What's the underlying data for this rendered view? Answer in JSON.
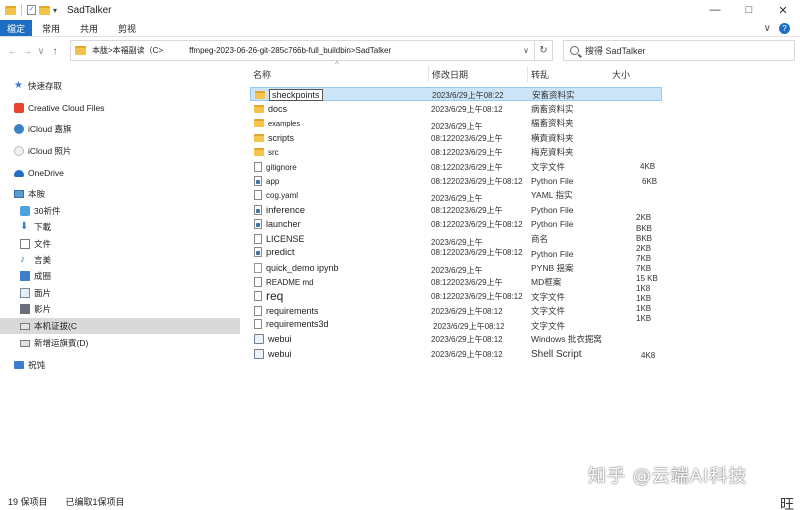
{
  "window": {
    "title": "SadTalker",
    "minimize": "—",
    "maximize": "□",
    "close": "✕",
    "quick_access_drop": "▾"
  },
  "ribbon": {
    "file": "檔定",
    "tabs": [
      "常用",
      "共用",
      "剪视"
    ],
    "expand": "∨",
    "help": "?"
  },
  "nav": {
    "back": "←",
    "forward": "→",
    "recent": "∨",
    "up": "↑",
    "path_part1": "本胧>本福副读（C>",
    "path_part2": "ffmpeg-2023-06-26-git-285c766b-full_buildbin>SadTalker",
    "address_drop": "∨",
    "refresh": "↻",
    "search_placeholder": "搜得 SadTalker"
  },
  "sidebar": {
    "items": [
      {
        "label": "快速存取",
        "icon": "star-icon"
      },
      {
        "label": "Creative Cloud Files",
        "icon": "creative-cloud-icon"
      },
      {
        "label": "iCloud 嘉旗",
        "icon": "icloud-drive-icon"
      },
      {
        "label": "iCloud 照片",
        "icon": "icloud-photos-icon"
      },
      {
        "label": "OneDrive",
        "icon": "onedrive-icon"
      },
      {
        "label": "本胺",
        "icon": "this-pc-icon"
      },
      {
        "label": "30祈件",
        "icon": "3d-objects-icon"
      },
      {
        "label": "下載",
        "icon": "download-icon"
      },
      {
        "label": "文件",
        "icon": "documents-icon"
      },
      {
        "label": "言美",
        "icon": "music-icon"
      },
      {
        "label": "成圈",
        "icon": "desktop-icon"
      },
      {
        "label": "面片",
        "icon": "pictures-icon"
      },
      {
        "label": "影片",
        "icon": "videos-icon"
      },
      {
        "label": "本机证拔(C",
        "icon": "local-disk-icon"
      },
      {
        "label": "新增运旗賓(D)",
        "icon": "drive-d-icon"
      },
      {
        "label": "祝饨",
        "icon": "network-icon"
      }
    ]
  },
  "columns": {
    "name": "名称",
    "date": "修改日期",
    "type": "转乱",
    "size": "大小",
    "sort_caret": "^"
  },
  "files": [
    {
      "name": "sheckpoints",
      "date": "2023/6/29上午08:22",
      "type": "安畜资料实",
      "icon": "folder-icon"
    },
    {
      "name": "docs",
      "date": "2023/6/29上午08:12",
      "type": "病畜资料实",
      "icon": "folder-icon"
    },
    {
      "name": "examples",
      "date": "2023/6/29上午",
      "type": "楅畜资料夹",
      "icon": "folder-icon"
    },
    {
      "name": "scripts",
      "date": "08:122023/6/29上午",
      "type": "横責資料夹",
      "icon": "folder-icon"
    },
    {
      "name": "src",
      "date": "08:122023/6/29上午",
      "type": "梅克資料夹",
      "icon": "folder-icon"
    },
    {
      "name": "gitignore",
      "date": "08:122023/6/29上午",
      "type": "文字文件",
      "icon": "file-icon"
    },
    {
      "name": "app",
      "date": "08:122023/6/29上午08:12",
      "type": "Python File",
      "icon": "python-file-icon"
    },
    {
      "name": "cog.yaml",
      "date": "2023/6/29上午",
      "type": "YAML 指实",
      "icon": "file-icon"
    },
    {
      "name": "inference",
      "date": "08:122023/6/29上午",
      "type": "Python File",
      "icon": "python-file-icon"
    },
    {
      "name": "launcher",
      "date": "08:122023/6/29上午08:12",
      "type": "Python File",
      "icon": "python-file-icon"
    },
    {
      "name": "LICENSE",
      "date": "2023/6/29上午",
      "type": "商名",
      "icon": "file-icon"
    },
    {
      "name": "predict",
      "date": "08:122023/6/29上午08:12",
      "type": "Python File",
      "icon": "python-file-icon"
    },
    {
      "name": "quick_demo ipynb",
      "date": "2023/6/29上午",
      "type": "PYNB 揺案",
      "icon": "notebook-file-icon"
    },
    {
      "name": "README md",
      "date": "08:122023/6/29上午",
      "type": "MD框案",
      "icon": "file-icon"
    },
    {
      "name": "req",
      "date": "08:122023/6/29上午08:12",
      "type": "文字文件",
      "icon": "file-icon"
    },
    {
      "name": "requirements",
      "date": "2023/6/29上午08:12",
      "type": "文字文件",
      "icon": "file-icon"
    },
    {
      "name": "requirements3d",
      "date": "2023/6/29上午08:12",
      "type": "文字文件",
      "icon": "file-icon"
    },
    {
      "name": "webui",
      "date": "2023/6/29上午08:12",
      "type": "Windows 批衣掘窝",
      "icon": "batch-file-icon"
    },
    {
      "name": "webui",
      "date": "2023/6/29上午08:12",
      "type": "Shell Script",
      "icon": "batch-file-icon"
    }
  ],
  "sizes": [
    "4KB",
    "6KB",
    "2KB",
    "BKB",
    "BKB",
    "2KB",
    "7KB",
    "7KB",
    "15 KB",
    "1K8",
    "1KB",
    "1KB",
    "1KB",
    "4K8"
  ],
  "status": {
    "count": "19 保项目",
    "selected": "已编取1保项目",
    "view_icon": "旺"
  },
  "watermark": "知乎 @云端AI科技"
}
